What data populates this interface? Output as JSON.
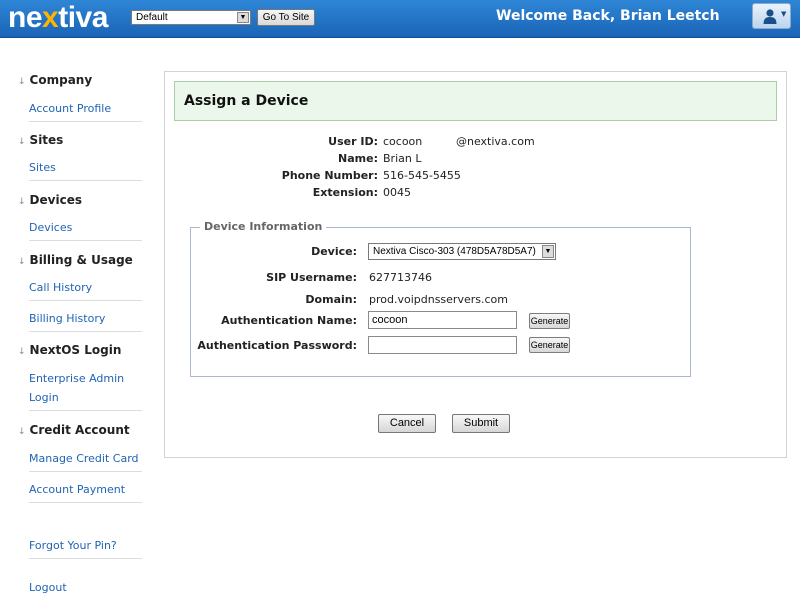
{
  "header": {
    "logo_pre": "ne",
    "logo_x": "x",
    "logo_post": "tiva",
    "site_select_value": "Default",
    "go_button_label": "Go To Site",
    "welcome_text": "Welcome Back, Brian Leetch",
    "user_menu_icon": "user-icon"
  },
  "sidebar": {
    "sections": [
      {
        "title": "Company",
        "links": [
          "Account Profile"
        ]
      },
      {
        "title": "Sites",
        "links": [
          "Sites"
        ]
      },
      {
        "title": "Devices",
        "links": [
          "Devices"
        ]
      },
      {
        "title": "Billing & Usage",
        "links": [
          "Call History",
          "Billing History"
        ]
      },
      {
        "title": "NextOS Login",
        "links": [
          "Enterprise Admin Login"
        ]
      },
      {
        "title": "Credit Account",
        "links": [
          "Manage Credit Card",
          "Account Payment"
        ]
      }
    ],
    "forgot_pin": "Forgot Your Pin?",
    "logout": "Logout"
  },
  "main": {
    "page_title": "Assign a Device",
    "user_info": {
      "user_id_label": "User ID:",
      "user_id_value": "cocoon",
      "user_id_domain": "@nextiva.com",
      "name_label": "Name:",
      "name_value": "Brian L",
      "phone_label": "Phone Number:",
      "phone_value": "516-545-5455",
      "extension_label": "Extension:",
      "extension_value": "0045"
    },
    "device_info": {
      "legend": "Device Information",
      "device_label": "Device:",
      "device_value": "Nextiva Cisco-303 (478D5A78D5A7)",
      "sip_label": "SIP Username:",
      "sip_value": "627713746",
      "domain_label": "Domain:",
      "domain_value": "prod.voipdnsservers.com",
      "auth_name_label": "Authentication Name:",
      "auth_name_value": "cocoon",
      "auth_password_label": "Authentication Password:",
      "auth_password_value": "",
      "generate_label": "Generate"
    },
    "cancel_label": "Cancel",
    "submit_label": "Submit"
  },
  "colors": {
    "header_blue": "#1f6fc4",
    "logo_accent": "#ffb400",
    "link_blue": "#1f64b4",
    "title_box_bg": "#eaf7ea"
  }
}
